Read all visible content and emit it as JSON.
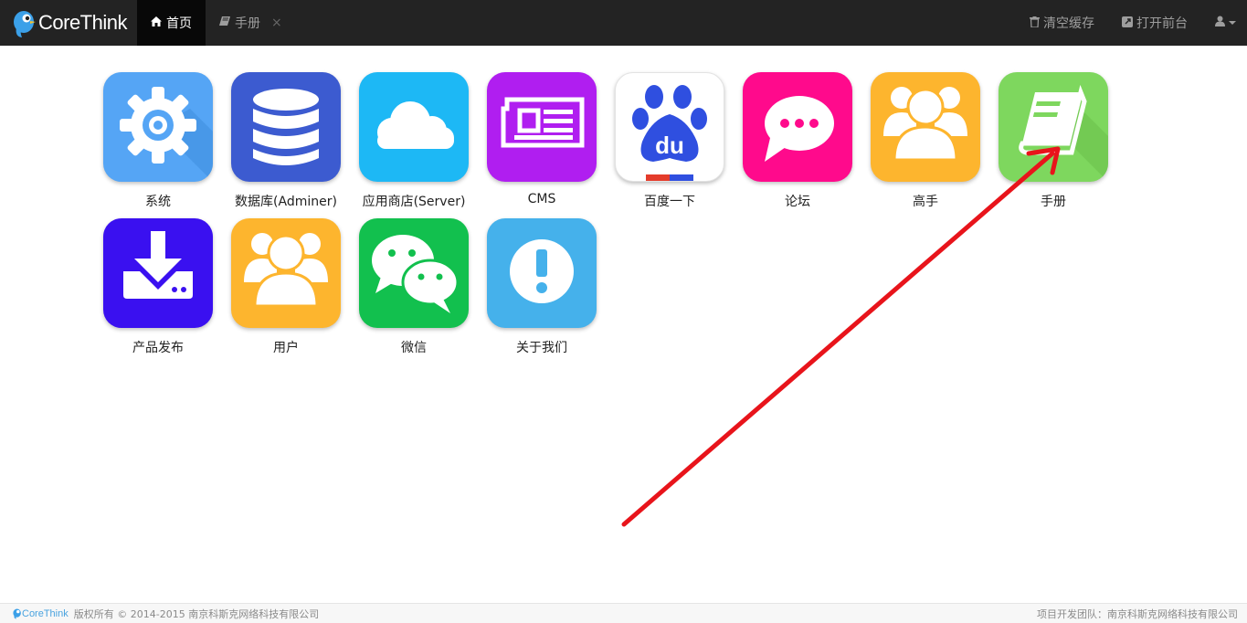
{
  "navbar": {
    "brand": "CoreThink",
    "tabs": [
      {
        "label": "首页",
        "icon": "home-icon",
        "active": true
      },
      {
        "label": "手册",
        "icon": "book-icon",
        "active": false,
        "close": "×"
      }
    ],
    "right": {
      "clear_cache": "清空缓存",
      "open_front": "打开前台",
      "user_menu_icon": "user-icon"
    }
  },
  "apps": [
    {
      "label": "系统",
      "icon": "gear-icon",
      "color": "#55A5F5"
    },
    {
      "label": "数据库(Adminer)",
      "icon": "database-icon",
      "color": "#3C5BD0"
    },
    {
      "label": "应用商店(Server)",
      "icon": "cloud-icon",
      "color": "#1DB8F5"
    },
    {
      "label": "CMS",
      "icon": "newspaper-icon",
      "color": "#B01EF0"
    },
    {
      "label": "百度一下",
      "icon": "baidu-paw-icon",
      "color": "#FFFFFF"
    },
    {
      "label": "论坛",
      "icon": "chat-bubble-icon",
      "color": "#FF0A8C"
    },
    {
      "label": "高手",
      "icon": "users-group-icon",
      "color": "#FDB52E"
    },
    {
      "label": "手册",
      "icon": "book-icon",
      "color": "#7ED75E"
    },
    {
      "label": "产品发布",
      "icon": "download-icon",
      "color": "#3A10F0"
    },
    {
      "label": "用户",
      "icon": "users-group-icon",
      "color": "#FDB52E"
    },
    {
      "label": "微信",
      "icon": "wechat-icon",
      "color": "#12C04E"
    },
    {
      "label": "关于我们",
      "icon": "exclamation-icon",
      "color": "#45B1EB"
    }
  ],
  "footer": {
    "logo_text": "CoreThink",
    "copyright": "版权所有 © 2014-2015 南京科斯克网络科技有限公司",
    "team": "项目开发团队：南京科斯克网络科技有限公司"
  },
  "annotation": {
    "arrow_color": "#E8141B"
  }
}
